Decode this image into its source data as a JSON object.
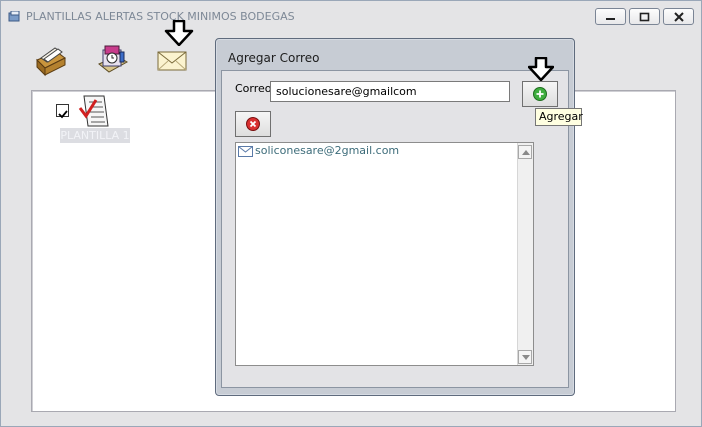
{
  "main_window": {
    "title": "PLANTILLAS ALERTAS STOCK MINIMOS BODEGAS",
    "template_item": {
      "label": "PLANTILLA 1",
      "checked": true
    }
  },
  "dialog": {
    "title": "Agregar Correo",
    "correo_label": "Correo",
    "correo_value": "solucionesare@gmailcom",
    "tooltip": "Agregar",
    "emails": [
      "soliconesare@2gmail.com"
    ]
  },
  "colors": {
    "dialog_bg": "#c7ccd4",
    "client_bg": "#e3e3e6",
    "email_text": "#3d6c7a",
    "delete_red": "#d93030",
    "add_green": "#3fae3f"
  },
  "icons": {
    "toolbar": [
      "card-file-icon",
      "alarm-clock-icon",
      "envelope-icon"
    ],
    "template": "checklist-document-icon",
    "arrows": [
      "down-arrow-icon"
    ]
  }
}
